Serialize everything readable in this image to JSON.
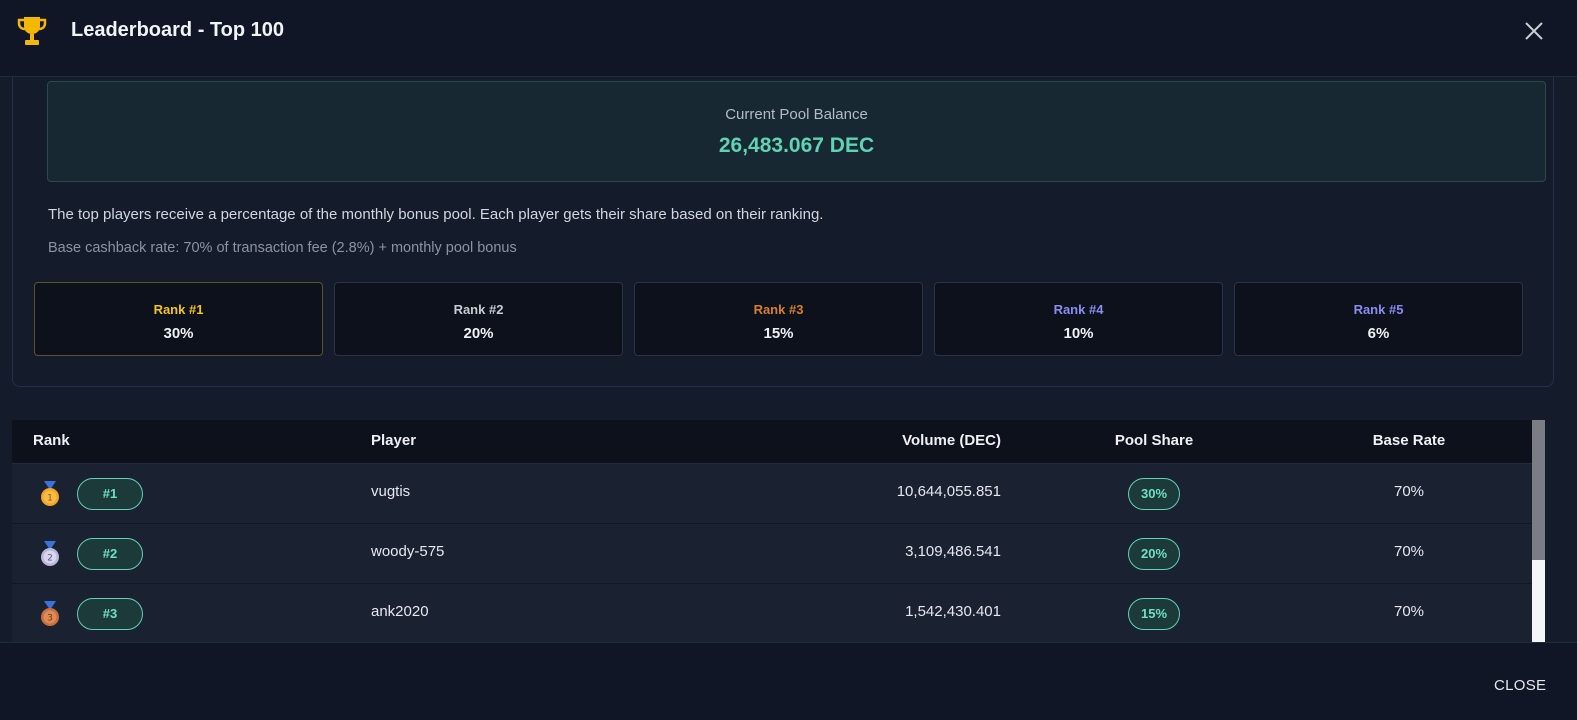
{
  "header": {
    "title": "Leaderboard - Top 100",
    "trophy_icon": "trophy-icon",
    "close_icon": "close-icon"
  },
  "pool": {
    "label": "Current Pool Balance",
    "value": "26,483.067 DEC",
    "description": "The top players receive a percentage of the monthly bonus pool. Each player gets their share based on their ranking.",
    "base_rate_note": "Base cashback rate: 70% of transaction fee (2.8%) + monthly pool bonus"
  },
  "rank_tiers": [
    {
      "name": "Rank #1",
      "pct": "30%",
      "color": "#f5c518"
    },
    {
      "name": "Rank #2",
      "pct": "20%",
      "color": "#c9ccd3"
    },
    {
      "name": "Rank #3",
      "pct": "15%",
      "color": "#d7802a"
    },
    {
      "name": "Rank #4",
      "pct": "10%",
      "color": "#8b8cf0"
    },
    {
      "name": "Rank #5",
      "pct": "6%",
      "color": "#8b8cf0"
    }
  ],
  "table": {
    "headers": {
      "rank": "Rank",
      "player": "Player",
      "volume": "Volume (DEC)",
      "pool_share": "Pool Share",
      "base_rate": "Base Rate"
    },
    "rows": [
      {
        "medal": "gold-medal-icon",
        "medal_number": "1",
        "rank": "#1",
        "player": "vugtis",
        "volume": "10,644,055.851",
        "pool_share": "30%",
        "base_rate": "70%"
      },
      {
        "medal": "silver-medal-icon",
        "medal_number": "2",
        "rank": "#2",
        "player": "woody-575",
        "volume": "3,109,486.541",
        "pool_share": "20%",
        "base_rate": "70%"
      },
      {
        "medal": "bronze-medal-icon",
        "medal_number": "3",
        "rank": "#3",
        "player": "ank2020",
        "volume": "1,542,430.401",
        "pool_share": "15%",
        "base_rate": "70%"
      }
    ]
  },
  "footer": {
    "close_label": "CLOSE"
  },
  "colors": {
    "accent": "#5fd3b4",
    "background": "#141b2b",
    "header_bg": "#101625"
  }
}
